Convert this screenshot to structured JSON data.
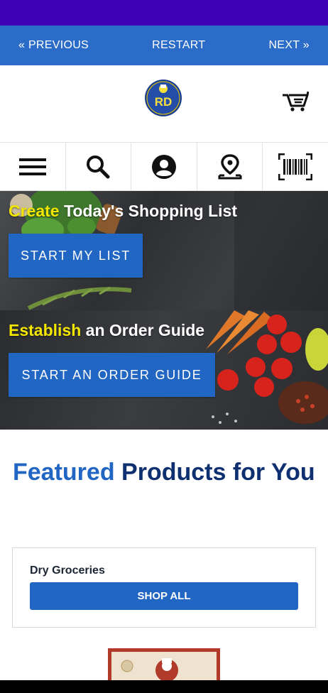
{
  "nav": {
    "previous": "« PREVIOUS",
    "restart": "RESTART",
    "next": "NEXT »"
  },
  "header": {
    "logo_text": "RD"
  },
  "hero_list": {
    "title_highlight": "Create",
    "title_rest": " Today's Shopping List",
    "button": "START MY LIST"
  },
  "hero_guide": {
    "title_highlight": "Establish",
    "title_rest": " an Order Guide",
    "button": "START AN ORDER GUIDE"
  },
  "featured": {
    "accent": "Featured",
    "rest": " Products for You"
  },
  "category_card": {
    "title": "Dry Groceries",
    "button": "SHOP ALL"
  },
  "colors": {
    "status_bar": "#3d00b3",
    "nav_strip": "#2a6cc7",
    "primary": "#2266c3",
    "heading": "#0e2f70",
    "highlight": "#f3e600"
  },
  "icons": [
    "menu-icon",
    "search-icon",
    "account-icon",
    "location-icon",
    "barcode-icon",
    "cart-icon"
  ]
}
